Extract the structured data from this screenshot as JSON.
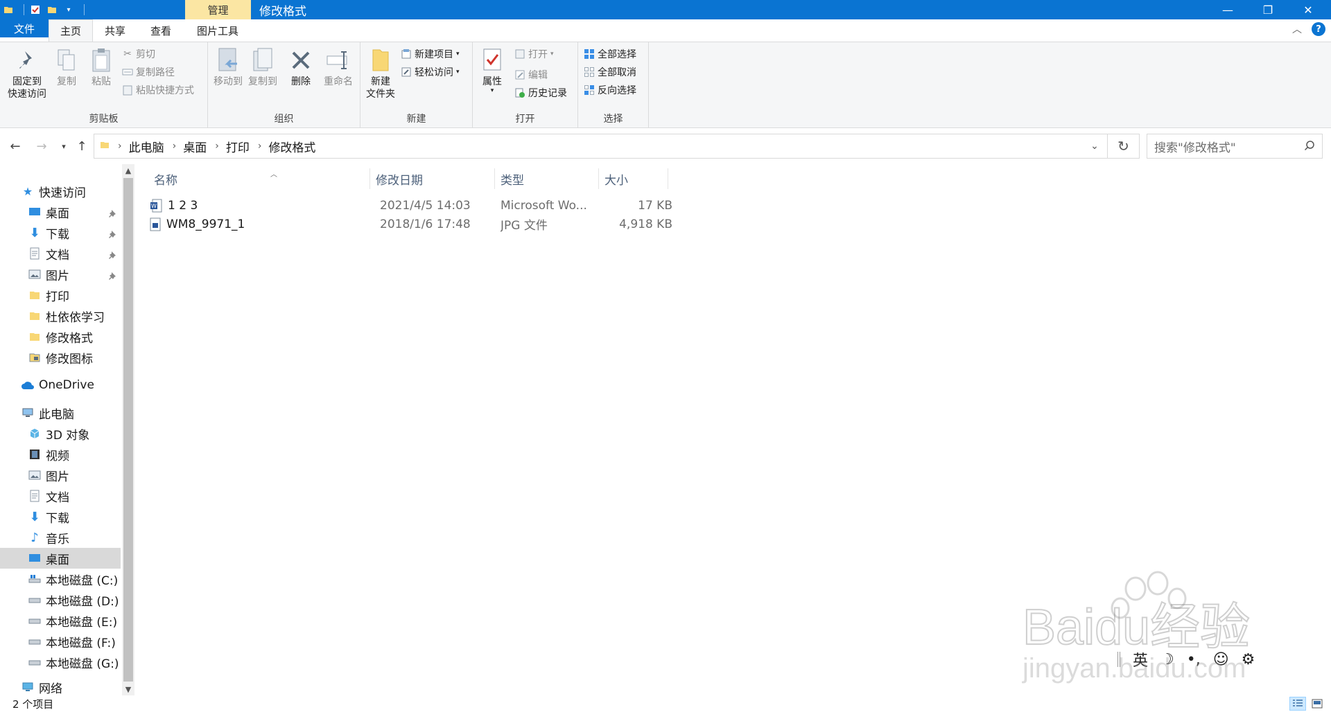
{
  "titlebar": {
    "context_tab": "管理",
    "title": "修改格式",
    "minimize": "—",
    "maximize": "❐",
    "close": "✕"
  },
  "tabs": {
    "file": "文件",
    "home": "主页",
    "share": "共享",
    "view": "查看",
    "picture_tools": "图片工具",
    "help": "?"
  },
  "ribbon": {
    "clipboard": {
      "label": "剪贴板",
      "pin_line1": "固定到",
      "pin_line2": "快速访问",
      "copy": "复制",
      "paste": "粘贴",
      "cut": "剪切",
      "copy_path": "复制路径",
      "paste_shortcut": "粘贴快捷方式"
    },
    "organize": {
      "label": "组织",
      "move_to": "移动到",
      "copy_to": "复制到",
      "delete": "删除",
      "rename": "重命名"
    },
    "new": {
      "label": "新建",
      "new_folder_line1": "新建",
      "new_folder_line2": "文件夹",
      "new_item": "新建项目",
      "easy_access": "轻松访问"
    },
    "open": {
      "label": "打开",
      "properties": "属性",
      "open": "打开",
      "edit": "编辑",
      "history": "历史记录"
    },
    "select": {
      "label": "选择",
      "select_all": "全部选择",
      "select_none": "全部取消",
      "invert": "反向选择"
    }
  },
  "address": {
    "crumbs": [
      "此电脑",
      "桌面",
      "打印",
      "修改格式"
    ],
    "search_placeholder": "搜索\"修改格式\""
  },
  "navpane": {
    "quick_access": "快速访问",
    "quick_items": [
      {
        "label": "桌面",
        "pinned": true
      },
      {
        "label": "下载",
        "pinned": true
      },
      {
        "label": "文档",
        "pinned": true
      },
      {
        "label": "图片",
        "pinned": true
      },
      {
        "label": "打印",
        "pinned": false
      },
      {
        "label": "杜依依学习",
        "pinned": false
      },
      {
        "label": "修改格式",
        "pinned": false
      },
      {
        "label": "修改图标",
        "pinned": false
      }
    ],
    "onedrive": "OneDrive",
    "this_pc": "此电脑",
    "pc_items": [
      "3D 对象",
      "视频",
      "图片",
      "文档",
      "下载",
      "音乐",
      "桌面",
      "本地磁盘 (C:)",
      "本地磁盘 (D:)",
      "本地磁盘 (E:)",
      "本地磁盘 (F:)",
      "本地磁盘 (G:)"
    ],
    "network": "网络",
    "selected": "桌面"
  },
  "filelist": {
    "columns": {
      "name": "名称",
      "date": "修改日期",
      "type": "类型",
      "size": "大小"
    },
    "rows": [
      {
        "name": "1 2 3",
        "date": "2021/4/5 14:03",
        "type": "Microsoft Wo...",
        "size": "17 KB",
        "icon": "word-doc-icon"
      },
      {
        "name": "WM8_9971_1",
        "date": "2018/1/6 17:48",
        "type": "JPG 文件",
        "size": "4,918 KB",
        "icon": "jpg-file-icon"
      }
    ]
  },
  "status": {
    "count": "2 个项目"
  },
  "ime": {
    "lang": "英",
    "moon": "☽",
    "punct": "•,",
    "emoji": "☺",
    "settings": "⚙"
  },
  "watermark": {
    "line1": "Baidu经验",
    "line2": "jingyan.baidu.com"
  },
  "colors": {
    "titlebar": "#0a74d2",
    "context_tab": "#fbe6a3",
    "ribbon_bg": "#f5f6f7",
    "selected_nav": "#d9d9d9",
    "header_text": "#4c607a"
  }
}
